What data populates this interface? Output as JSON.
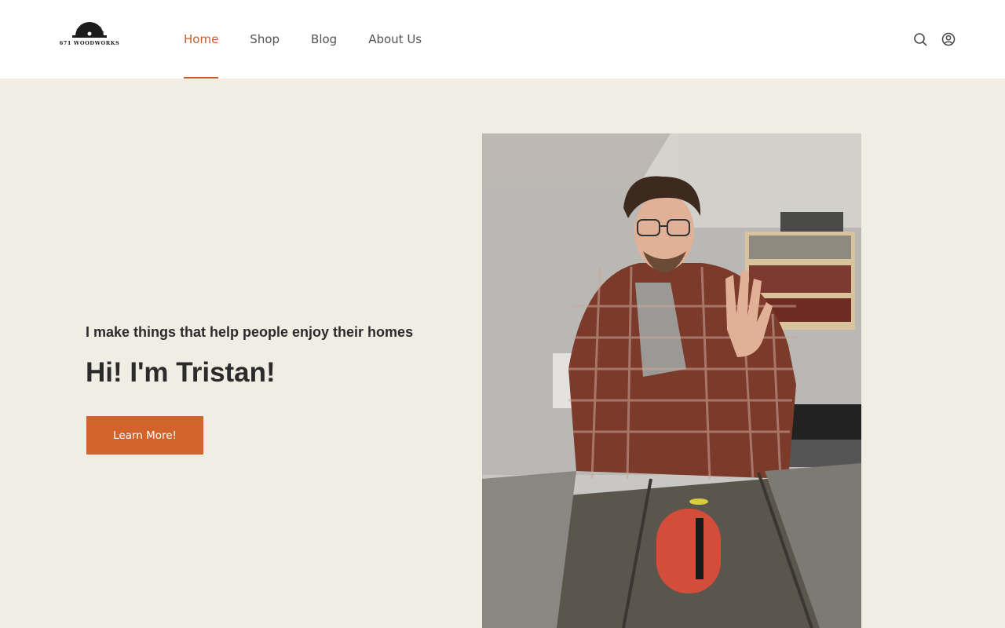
{
  "header": {
    "logo_text": "671 WOODWORKS",
    "nav": [
      {
        "label": "Home",
        "active": true
      },
      {
        "label": "Shop",
        "active": false
      },
      {
        "label": "Blog",
        "active": false
      },
      {
        "label": "About Us",
        "active": false
      }
    ],
    "icons": [
      "search-icon",
      "account-icon"
    ]
  },
  "hero": {
    "subtitle": "I make things that help people enjoy their homes",
    "headline": "Hi! I'm Tristan!",
    "cta_label": "Learn More!"
  },
  "colors": {
    "accent": "#c25e2d",
    "button": "#d2632b",
    "background": "#f0ede5",
    "header_bg": "#ffffff",
    "text_dark": "#2b2b2b"
  }
}
